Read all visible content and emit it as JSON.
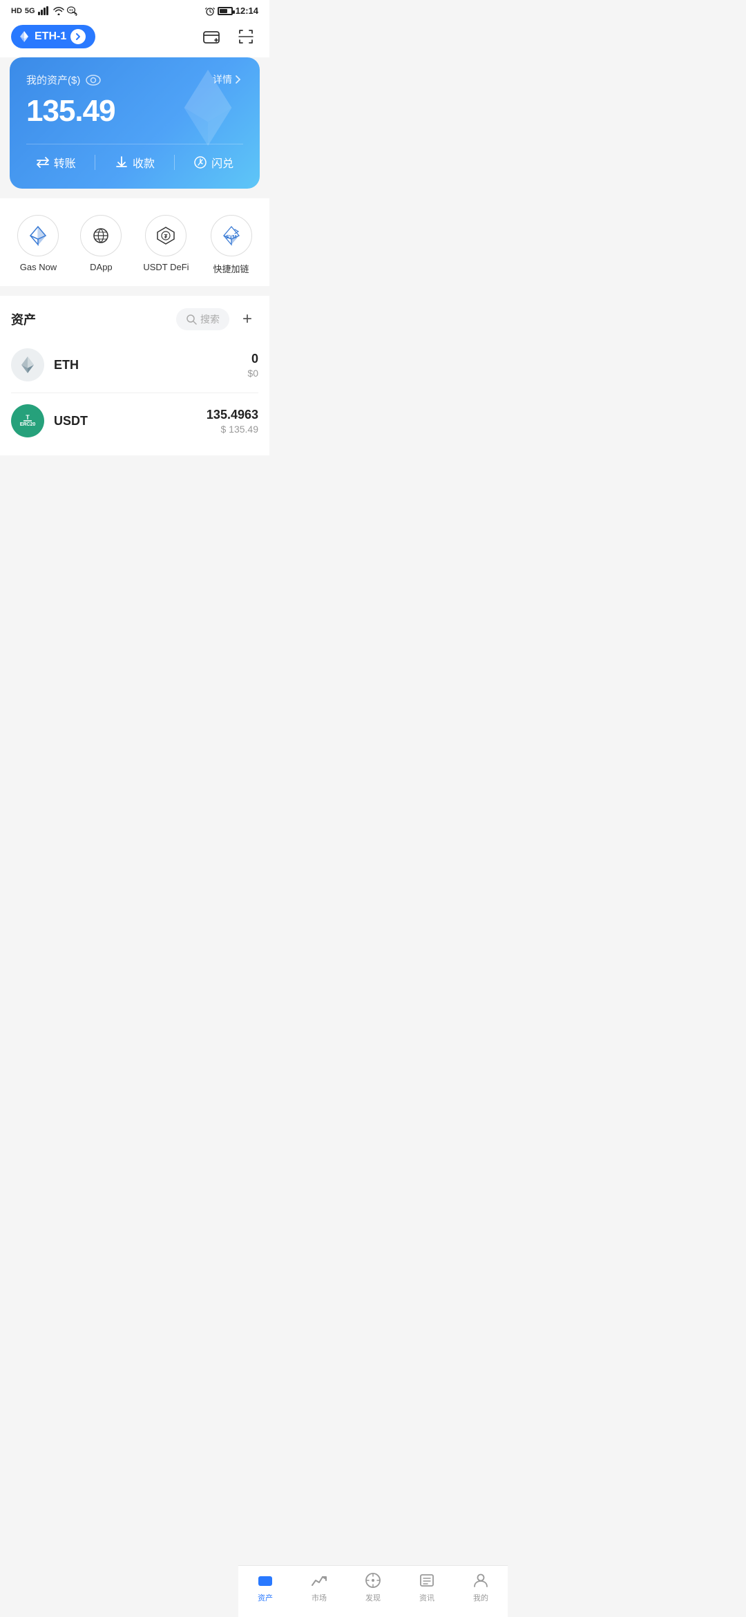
{
  "statusBar": {
    "left": "HD 5G",
    "time": "12:14",
    "battery": "64"
  },
  "header": {
    "networkLabel": "ETH-1",
    "walletIconLabel": "wallet-icon",
    "scanIconLabel": "scan-icon"
  },
  "assetCard": {
    "label": "我的资产($)",
    "detailLabel": "详情",
    "amount": "135.49",
    "actions": [
      {
        "id": "transfer",
        "label": "转账",
        "icon": "transfer-icon"
      },
      {
        "id": "receive",
        "label": "收款",
        "icon": "receive-icon"
      },
      {
        "id": "flash",
        "label": "闪兑",
        "icon": "flash-icon"
      }
    ]
  },
  "quickNav": [
    {
      "id": "gas-now",
      "label": "Gas Now",
      "icon": "gas-icon"
    },
    {
      "id": "dapp",
      "label": "DApp",
      "icon": "dapp-icon"
    },
    {
      "id": "usdt-defi",
      "label": "USDT DeFi",
      "icon": "defi-icon"
    },
    {
      "id": "quick-chain",
      "label": "快捷加链",
      "icon": "chain-icon"
    }
  ],
  "assetsSection": {
    "title": "资产",
    "searchPlaceholder": "搜索",
    "addLabel": "+",
    "items": [
      {
        "id": "eth",
        "name": "ETH",
        "amount": "0",
        "usdValue": "$0"
      },
      {
        "id": "usdt",
        "name": "USDT",
        "amount": "135.4963",
        "usdValue": "$ 135.49"
      }
    ]
  },
  "tabBar": {
    "tabs": [
      {
        "id": "assets",
        "label": "资产",
        "active": true
      },
      {
        "id": "market",
        "label": "市场",
        "active": false
      },
      {
        "id": "discover",
        "label": "发现",
        "active": false
      },
      {
        "id": "news",
        "label": "资讯",
        "active": false
      },
      {
        "id": "mine",
        "label": "我的",
        "active": false
      }
    ]
  }
}
